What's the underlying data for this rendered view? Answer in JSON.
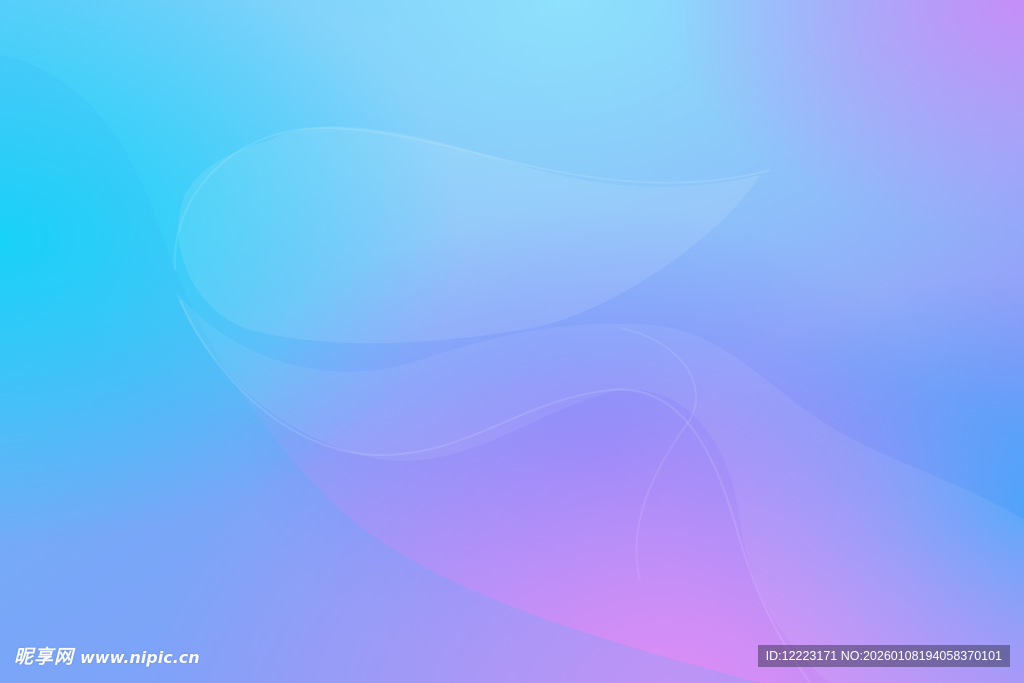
{
  "watermark": {
    "brand": "昵享网",
    "url": "www.nipic.cn"
  },
  "idbar": {
    "id": "ID:12223171",
    "no": "NO:20260108194058370101"
  },
  "colors": {
    "cyan": "#1fd4f7",
    "sky": "#7fd9fb",
    "blue": "#6aa8f7",
    "indigo": "#8c86f7",
    "violet": "#b58bf6",
    "pink": "#d98ef6",
    "azure": "#48a9f8"
  }
}
